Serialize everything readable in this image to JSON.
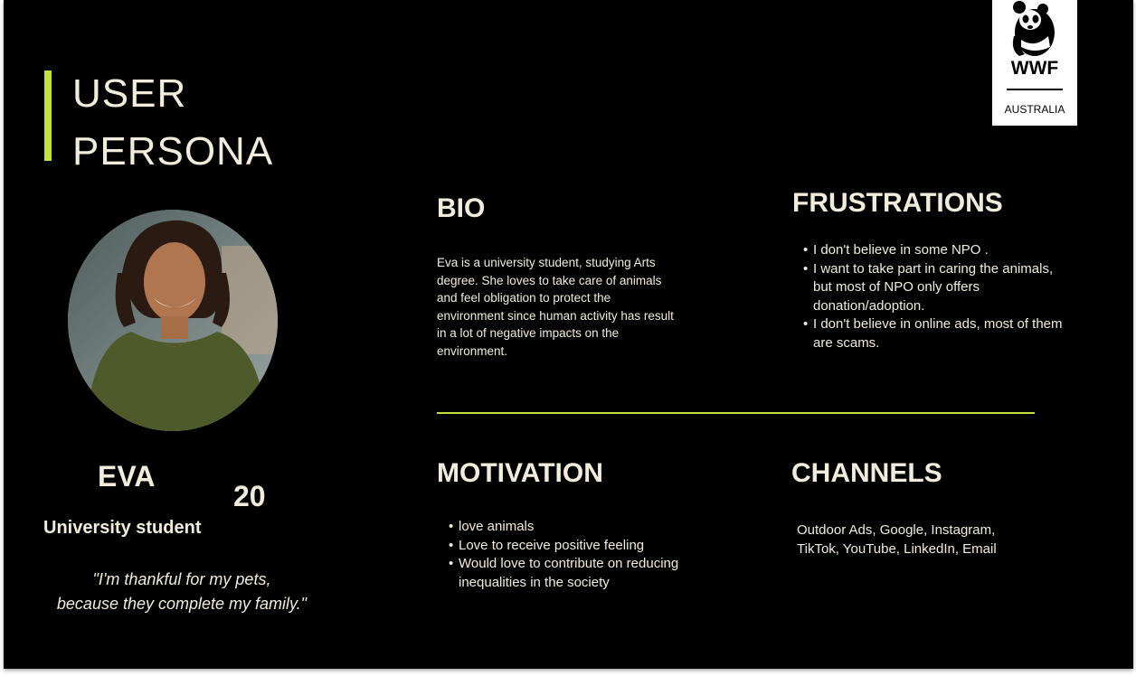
{
  "title": {
    "line1": "USER",
    "line2": "PERSONA"
  },
  "logo": {
    "brand": "WWF",
    "country": "AUSTRALIA"
  },
  "persona": {
    "name": "EVA",
    "age": "20",
    "role": "University student",
    "quote_line1": "\"I'm thankful for my pets,",
    "quote_line2": "because they complete my family.\""
  },
  "bio": {
    "heading": "BIO",
    "text": "Eva is a university student, studying Arts degree. She loves to take care of animals and feel obligation to protect the environment since human activity has result in a lot of negative impacts on the environment."
  },
  "frustrations": {
    "heading": "FRUSTRATIONS",
    "items": [
      "I don't believe in some NPO .",
      "I want to take part in caring the animals, but most of NPO only offers donation/adoption.",
      "I don't believe in online ads, most of them are scams."
    ]
  },
  "motivation": {
    "heading": "MOTIVATION",
    "items": [
      "love animals",
      "Love to receive positive feeling",
      "Would love to contribute on reducing inequalities in the society"
    ]
  },
  "channels": {
    "heading": "CHANNELS",
    "text": "Outdoor Ads, Google, Instagram, TikTok, YouTube, LinkedIn, Email"
  },
  "colors": {
    "accent": "#c6e03c",
    "background": "#000000",
    "text": "#f2ecdc"
  }
}
